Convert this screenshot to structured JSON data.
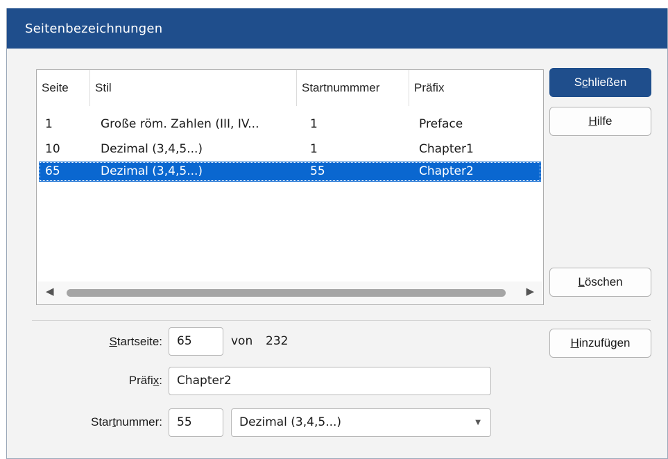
{
  "window": {
    "title": "Seitenbezeichnungen"
  },
  "list": {
    "columns": [
      "Seite",
      "Stil",
      "Startnummmer",
      "Präfix"
    ],
    "rows": [
      {
        "seite": "1",
        "stil": "Große röm. Zahlen (III, IV...",
        "start": "1",
        "praefix": "Preface",
        "selected": false
      },
      {
        "seite": "10",
        "stil": "Dezimal (3,4,5...)",
        "start": "1",
        "praefix": "Chapter1",
        "selected": false
      },
      {
        "seite": "65",
        "stil": "Dezimal (3,4,5...)",
        "start": "55",
        "praefix": "Chapter2",
        "selected": true
      }
    ]
  },
  "buttons": {
    "close": {
      "pre": "S",
      "mn": "c",
      "post": "hließen"
    },
    "help": {
      "pre": "",
      "mn": "H",
      "post": "ilfe"
    },
    "delete": {
      "pre": "",
      "mn": "L",
      "post": "öschen"
    },
    "add": {
      "pre": "",
      "mn": "H",
      "post": "inzufügen"
    }
  },
  "form": {
    "startpage": {
      "label_pre": "",
      "label_mn": "S",
      "label_post": "tartseite:",
      "value": "65",
      "of_label": "von",
      "total": "232"
    },
    "prefix": {
      "label_pre": "Präfi",
      "label_mn": "x",
      "label_post": ":",
      "value": "Chapter2"
    },
    "startnum": {
      "label_pre": "Star",
      "label_mn": "t",
      "label_post": "nummer:",
      "value": "55",
      "style_selected": "Dezimal (3,4,5...)"
    }
  },
  "colors": {
    "accent": "#1f4e8c",
    "selection": "#0a67d0"
  }
}
